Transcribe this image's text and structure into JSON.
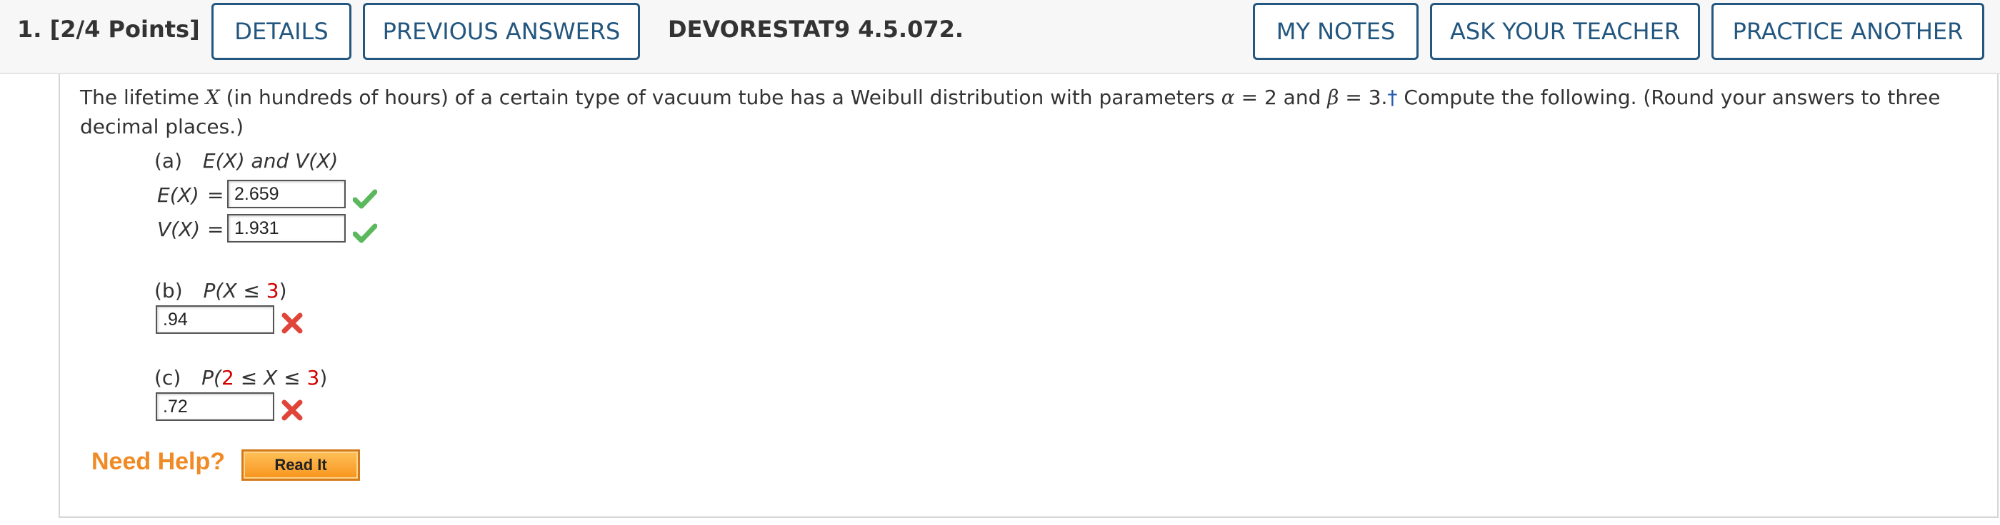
{
  "header": {
    "question_number": "1.",
    "points": "[2/4 Points]",
    "details_label": "DETAILS",
    "previous_answers_label": "PREVIOUS ANSWERS",
    "problem_code": "DEVORESTAT9 4.5.072.",
    "my_notes_label": "MY NOTES",
    "ask_teacher_label": "ASK YOUR TEACHER",
    "practice_another_label": "PRACTICE ANOTHER"
  },
  "question": {
    "prompt_1": "The lifetime ",
    "var_x": "X",
    "prompt_2": " (in hundreds of hours) of a certain type of vacuum tube has a Weibull distribution with parameters ",
    "alpha": "α",
    "prompt_3": " = 2 and ",
    "beta": "β",
    "prompt_4": " = 3.",
    "dagger": "†",
    "prompt_5": " Compute the following. (Round your answers to three decimal places.)"
  },
  "part_a": {
    "label": "(a)",
    "expr": "E(X) and V(X)",
    "ex_label": "E(X)",
    "ex_value": "2.659",
    "ex_status": "correct",
    "vx_label": "V(X)",
    "vx_value": "1.931",
    "vx_status": "correct"
  },
  "part_b": {
    "label": "(b)",
    "expr_pre": "P(X ≤ ",
    "expr_num": "3",
    "expr_post": ")",
    "value": ".94",
    "status": "incorrect"
  },
  "part_c": {
    "label": "(c)",
    "expr_pre": "P(",
    "expr_num1": "2",
    "expr_mid": " ≤ X ≤ ",
    "expr_num2": "3",
    "expr_post": ")",
    "value": ".72",
    "status": "incorrect"
  },
  "help": {
    "label": "Need Help?",
    "read_it_label": "Read It"
  },
  "colors": {
    "button_border": "#24577f",
    "correct": "#5cb85c",
    "incorrect": "#e0453a",
    "help": "#f08a24"
  }
}
